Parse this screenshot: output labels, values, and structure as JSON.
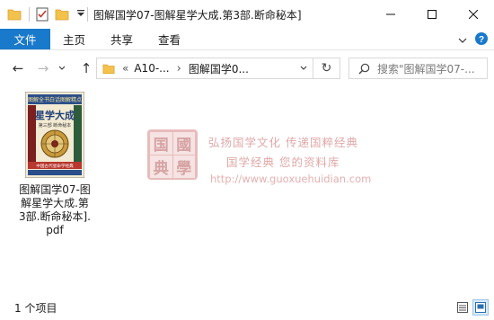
{
  "window": {
    "title": "图解国学07-图解星学大成.第3部.断命秘本]",
    "min_glyph": "—",
    "max_glyph": "☐",
    "close_glyph": "✕"
  },
  "ribbon": {
    "file_tab": "文件",
    "tabs": [
      "主页",
      "共享",
      "查看"
    ]
  },
  "nav": {
    "back_glyph": "←",
    "forward_glyph": "→",
    "recent_glyph": "⌄",
    "up_glyph": "↑"
  },
  "address": {
    "overflow": "«",
    "segments": [
      "A10-...",
      "图解国学0..."
    ],
    "separator": "›",
    "refresh_glyph": "↻"
  },
  "search": {
    "placeholder": "搜索\"图解国学07-..."
  },
  "files": [
    {
      "name": "图解国学07-图解星学大成.第3部.断命秘本].pdf",
      "cover": {
        "top_banner": "图解全书白话图解精点",
        "title": "星学大成",
        "subtitle": "第三部 断命秘本",
        "bottom_banner": "中国古代星命学经典"
      }
    }
  ],
  "watermark": {
    "seal_chars": [
      "国",
      "國",
      "典",
      "學"
    ],
    "line1": "弘扬国学文化  传递国粹经典",
    "line2": "国学经典  您的资料库",
    "url": "http://www.guoxuehuidian.com"
  },
  "status": {
    "item_count": "1 个项目"
  },
  "colors": {
    "accent": "#1979ca",
    "folder": "#f3c24d",
    "watermark": "#e0a8a8"
  }
}
